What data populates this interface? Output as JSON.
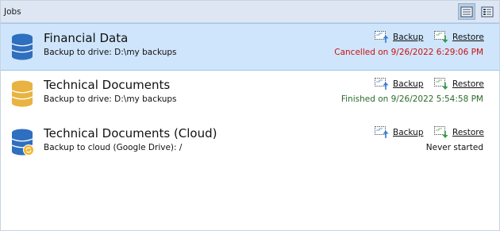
{
  "header": {
    "title": "Jobs"
  },
  "jobs": [
    {
      "title": "Financial Data",
      "subtitle": "Backup to drive: D:\\my backups",
      "status": "Cancelled on 9/26/2022 6:29:06 PM",
      "status_color": "#cc1111",
      "icon_color": "#2f6fbf",
      "icon": "database-icon",
      "selected": true,
      "backup_label": "Backup",
      "restore_label": "Restore"
    },
    {
      "title": "Technical Documents",
      "subtitle": "Backup to drive: D:\\my backups",
      "status": "Finished on 9/26/2022 5:54:58 PM",
      "status_color": "#2b6b2b",
      "icon_color": "#e8b341",
      "icon": "database-icon",
      "selected": false,
      "backup_label": "Backup",
      "restore_label": "Restore"
    },
    {
      "title": "Technical Documents (Cloud)",
      "subtitle": "Backup to cloud (Google Drive): /",
      "status": "Never started",
      "status_color": "#111111",
      "icon_color": "#2f6fbf",
      "icon": "cloud-database-icon",
      "selected": false,
      "backup_label": "Backup",
      "restore_label": "Restore"
    }
  ],
  "view_buttons": [
    {
      "icon": "list-view-icon",
      "active": true
    },
    {
      "icon": "details-view-icon",
      "active": false
    }
  ]
}
